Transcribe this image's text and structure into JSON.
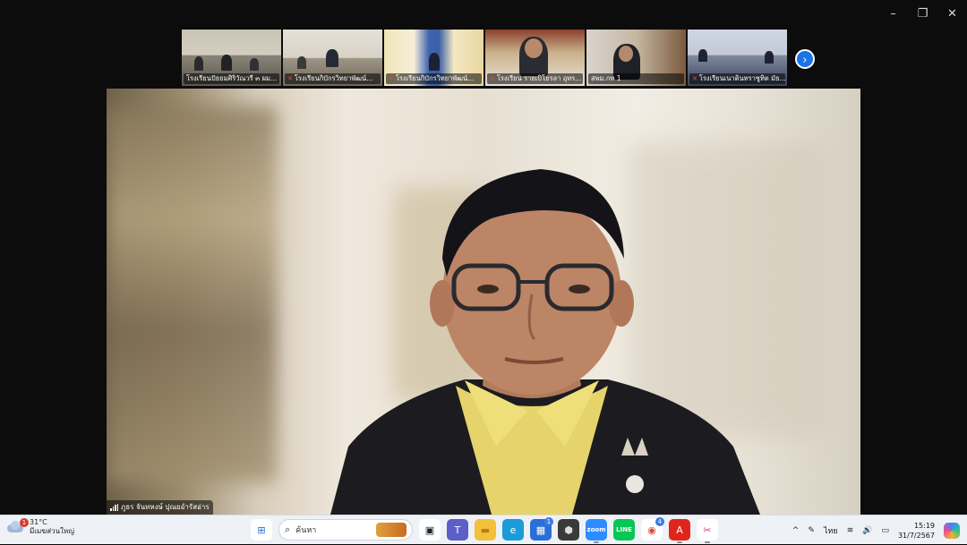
{
  "window": {
    "controls": {
      "minimize": "–",
      "restore": "❐",
      "close": "✕"
    }
  },
  "thumbnails": [
    {
      "label": "โรงเรียนปัธยมศิริวัณวรี ๓ ผม...",
      "muted": false,
      "active": true
    },
    {
      "label": "โรงเรียนกิบักรวิทยาพัฒน์...",
      "muted": true,
      "active": false
    },
    {
      "label": "โรงเรียนกิบักรวิทยาพัฒน์...",
      "muted": true,
      "active": false
    },
    {
      "label": "โรงเรียน รายเบิโยรลา อุทร...",
      "muted": true,
      "active": false
    },
    {
      "label": "สพม.กท 1",
      "muted": false,
      "active": false
    },
    {
      "label": "โรงเรียนเนาตินทราชูทิต มัธ...",
      "muted": true,
      "active": false
    }
  ],
  "next_button": "›",
  "speaker": {
    "name": "ภูธร จันทหงษ์ ปุณยอำรัสอ่าร"
  },
  "taskbar": {
    "weather": {
      "temp": "31°C",
      "desc": "มีเมฆส่วนใหญ่",
      "badge": "1"
    },
    "search_placeholder": "ค้นหา",
    "apps": [
      {
        "name": "windows-start",
        "glyph": "⊞",
        "bg": "#ffffff",
        "fg": "#1f6fd6"
      },
      {
        "name": "search",
        "glyph": "",
        "bg": "",
        "fg": ""
      },
      {
        "name": "task-view",
        "glyph": "▣",
        "bg": "#ffffff",
        "fg": "#222"
      },
      {
        "name": "teams",
        "glyph": "T",
        "bg": "#5b5fc7",
        "fg": "#fff"
      },
      {
        "name": "file-explorer",
        "glyph": "▬",
        "bg": "#f3c03b",
        "fg": "#b57f12"
      },
      {
        "name": "edge",
        "glyph": "e",
        "bg": "#1b9bd7",
        "fg": "#fff"
      },
      {
        "name": "store",
        "glyph": "▦",
        "bg": "#2a6fd6",
        "fg": "#fff",
        "badge": "1"
      },
      {
        "name": "dark-app",
        "glyph": "⬢",
        "bg": "#3a3a3a",
        "fg": "#ddd"
      },
      {
        "name": "zoom",
        "glyph": "zoom",
        "bg": "#2d8cff",
        "fg": "#fff",
        "active": true
      },
      {
        "name": "line",
        "glyph": "LINE",
        "bg": "#06c755",
        "fg": "#fff"
      },
      {
        "name": "chrome",
        "glyph": "◉",
        "bg": "#ffffff",
        "fg": "#db4437",
        "badge": "4"
      },
      {
        "name": "acrobat",
        "glyph": "A",
        "bg": "#e1251b",
        "fg": "#fff",
        "active": true
      },
      {
        "name": "snipping",
        "glyph": "✂",
        "bg": "#ffffff",
        "fg": "#d0447a",
        "active": true
      }
    ],
    "tray": {
      "chevron": "^",
      "pen": "✎",
      "lang": "ไทย",
      "wifi": "≋",
      "volume": "🔊",
      "battery": "▭"
    },
    "clock": {
      "time": "15:19",
      "date": "31/7/2567"
    }
  },
  "colors": {
    "active_thumb_border": "#3cc56a",
    "next_button": "#1a73e8"
  }
}
